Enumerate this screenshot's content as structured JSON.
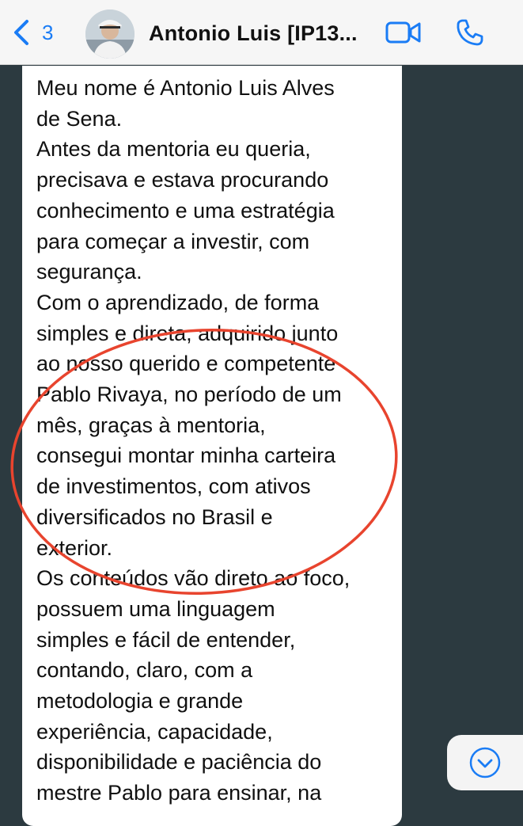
{
  "header": {
    "back_count": "3",
    "contact_name": "Antonio Luis [IP13..."
  },
  "message": {
    "lines": [
      "Meu nome é Antonio Luis Alves",
      "de Sena.",
      "Antes da mentoria eu queria,",
      "precisava e estava procurando",
      "conhecimento e uma estratégia",
      "para começar a investir, com",
      "segurança.",
      "Com o aprendizado, de forma",
      "simples e direta, adquirido junto",
      "ao nosso querido e competente",
      "Pablo Rivaya, no período de um",
      "mês, graças à mentoria,",
      "consegui montar minha carteira",
      "de investimentos, com ativos",
      "diversificados no Brasil e",
      "exterior.",
      "Os conteúdos vão direto ao foco,",
      "possuem uma linguagem",
      "simples e fácil de entender,",
      "contando, claro, com a",
      "metodologia e grande",
      "experiência, capacidade,",
      "disponibilidade e paciência do",
      "mestre Pablo para ensinar, na"
    ]
  },
  "colors": {
    "accent": "#1a7cf5",
    "annotation": "#e8442e",
    "chat_background": "#2c3a40"
  }
}
